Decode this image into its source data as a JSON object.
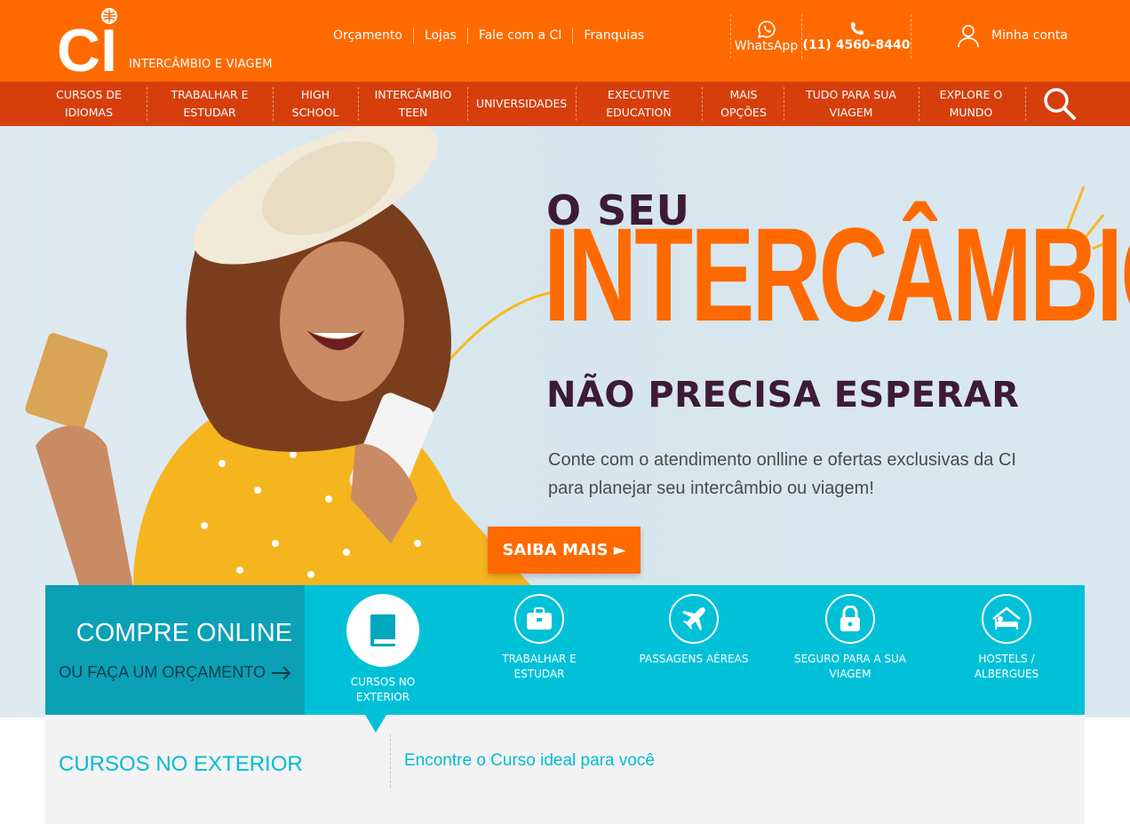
{
  "header": {
    "logo_text": "CI",
    "tagline": "INTERCÂMBIO E VIAGEM",
    "links": [
      "Orçamento",
      "Lojas",
      "Fale com a CI",
      "Franquias"
    ],
    "whatsapp_label": "WhatsApp",
    "phone": "(11) 4560-8440",
    "account_label": "Minha conta"
  },
  "nav": {
    "items": [
      {
        "l1": "CURSOS DE",
        "l2": "IDIOMAS"
      },
      {
        "l1": "TRABALHAR E",
        "l2": "ESTUDAR"
      },
      {
        "l1": "HIGH",
        "l2": "SCHOOL"
      },
      {
        "l1": "INTERCÂMBIO",
        "l2": "TEEN"
      },
      {
        "l1": "UNIVERSIDADES",
        "l2": ""
      },
      {
        "l1": "EXECUTIVE",
        "l2": "EDUCATION"
      },
      {
        "l1": "MAIS",
        "l2": "OPÇÕES"
      },
      {
        "l1": "TUDO PARA SUA",
        "l2": "VIAGEM"
      },
      {
        "l1": "EXPLORE O",
        "l2": "MUNDO"
      }
    ]
  },
  "hero": {
    "line1": "O SEU",
    "line2": "INTERCÂMBIO",
    "line3": "NÃO PRECISA ESPERAR",
    "desc1": "Conte com o atendimento onlline e ofertas exclusivas da CI",
    "desc2": "para planejar seu intercâmbio ou viagem!",
    "cta": "SAIBA MAIS ►"
  },
  "buy": {
    "title": "COMPRE ONLINE",
    "subtitle": "OU FAÇA UM ORÇAMENTO",
    "items": [
      {
        "l1": "CURSOS NO",
        "l2": "EXTERIOR",
        "icon": "book-icon"
      },
      {
        "l1": "TRABALHAR E",
        "l2": "ESTUDAR",
        "icon": "briefcase-icon"
      },
      {
        "l1": "PASSAGENS AÉREAS",
        "l2": "",
        "icon": "airplane-icon"
      },
      {
        "l1": "SEGURO PARA A SUA",
        "l2": "VIAGEM",
        "icon": "lock-icon"
      },
      {
        "l1": "HOSTELS /",
        "l2": "ALBERGUES",
        "icon": "bed-icon"
      }
    ]
  },
  "bottom": {
    "title": "CURSOS NO EXTERIOR",
    "lead": "Encontre o Curso ideal para você"
  },
  "colors": {
    "orange": "#ff6a00",
    "nav_red": "#d63f0c",
    "teal": "#00c1d8",
    "teal_dark": "#0aa0b5",
    "plum": "#3d1b36"
  }
}
